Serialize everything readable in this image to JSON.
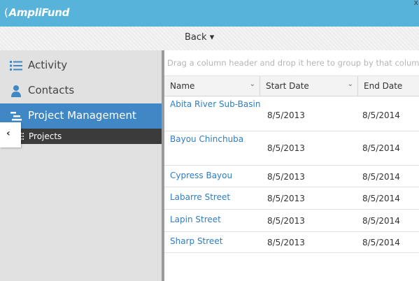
{
  "app": {
    "logo": "AmpliFund",
    "logo_paren": "(",
    "close_glyph": "x"
  },
  "toolbar": {
    "back_label": "Back ▾"
  },
  "sidebar": {
    "items": [
      {
        "label": "Activity",
        "icon": "list-icon"
      },
      {
        "label": "Contacts",
        "icon": "person-icon"
      },
      {
        "label": "Project Management",
        "icon": "project-icon"
      }
    ],
    "sub_items": [
      {
        "label": "Projects",
        "icon": "grid-icon"
      }
    ],
    "collapse_glyph": "‹"
  },
  "grid": {
    "group_placeholder": "Drag a column header and drop it here to group by that column",
    "columns": [
      "Name",
      "Start Date",
      "End Date"
    ],
    "rows": [
      {
        "name": "Abita River Sub-Basin",
        "start": "8/5/2013",
        "end": "8/5/2014"
      },
      {
        "name": "Bayou Chinchuba",
        "start": "8/5/2013",
        "end": "8/5/2014"
      },
      {
        "name": "Cypress Bayou",
        "start": "8/5/2013",
        "end": "8/5/2014"
      },
      {
        "name": "Labarre Street",
        "start": "8/5/2013",
        "end": "8/5/2014"
      },
      {
        "name": "Lapin Street",
        "start": "8/5/2013",
        "end": "8/5/2014"
      },
      {
        "name": "Sharp Street",
        "start": "8/5/2013",
        "end": "8/5/2014"
      }
    ]
  },
  "colors": {
    "topbar": "#58b3da",
    "accent": "#3f88c5",
    "link": "#2f7dc0",
    "sidebar": "#e1e1e1"
  }
}
